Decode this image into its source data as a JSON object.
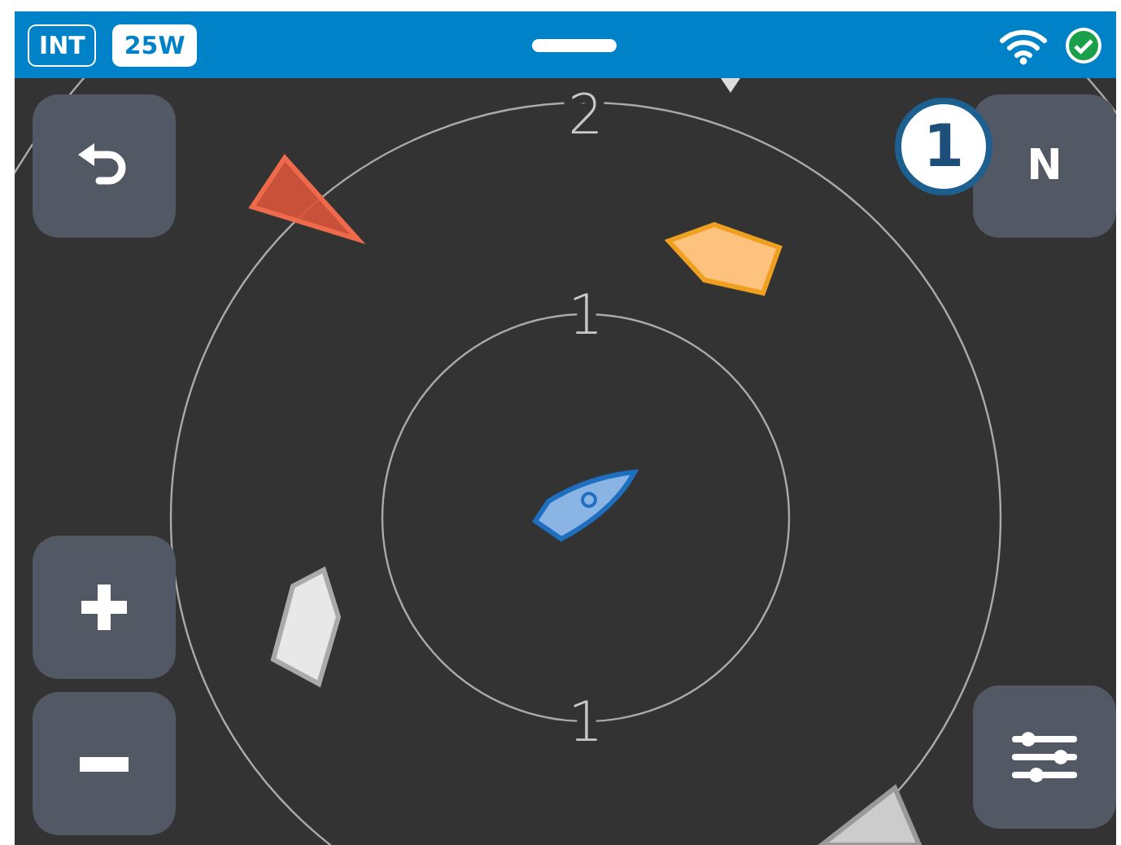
{
  "status_bar": {
    "badges": [
      {
        "label": "INT",
        "kind": "outline"
      },
      {
        "label": "25W",
        "kind": "filled"
      }
    ],
    "connected": true
  },
  "range_labels": [
    "2",
    "1",
    "1"
  ],
  "callout": {
    "label": "1"
  },
  "controls": {
    "heading_button": "N"
  }
}
